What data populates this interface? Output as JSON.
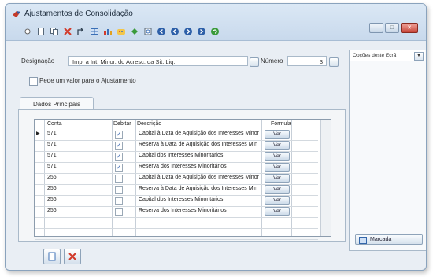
{
  "window": {
    "title": "Ajustamentos de Consolidação",
    "controls": [
      "minimize",
      "maximize",
      "close"
    ]
  },
  "toolbar": {
    "icons": [
      "dropdown-icon",
      "new-doc-icon",
      "copy-icon",
      "delete-icon",
      "arrows-icon",
      "grid-icon",
      "chart-icon",
      "palette-icon",
      "puzzle-icon",
      "print-preview-icon",
      "nav-first-icon",
      "nav-prev-icon",
      "nav-next-icon",
      "nav-last-icon",
      "refresh-icon"
    ]
  },
  "form": {
    "designacao_label": "Designação",
    "designacao_value": "Imp. a Int. Minor. do Acresc. da Sit. Liq.",
    "numero_label": "Número",
    "numero_value": "3",
    "pede_valor_label": "Pede um valor para o Ajustamento"
  },
  "tabs": [
    {
      "label": "Dados Principais"
    }
  ],
  "grid": {
    "headers": {
      "conta": "Conta",
      "debitar": "Debitar",
      "descricao": "Descrição",
      "formula": "Fórmula"
    },
    "rows": [
      {
        "conta": "571",
        "debitar": true,
        "descricao": "Capital à Data de Aquisição dos Interesses Minor",
        "formula": "Ver"
      },
      {
        "conta": "571",
        "debitar": true,
        "descricao": "Reserva à Data de Aquisição dos Interesses Min",
        "formula": "Ver"
      },
      {
        "conta": "571",
        "debitar": true,
        "descricao": "Capital dos Interesses Minoritários",
        "formula": "Ver"
      },
      {
        "conta": "571",
        "debitar": true,
        "descricao": "Reserva dos Interesses Minoritários",
        "formula": "Ver"
      },
      {
        "conta": "256",
        "debitar": false,
        "descricao": "Capital à Data de Aquisição dos Interesses Minor",
        "formula": "Ver"
      },
      {
        "conta": "256",
        "debitar": false,
        "descricao": "Reserva à Data de Aquisição dos Interesses Min",
        "formula": "Ver"
      },
      {
        "conta": "256",
        "debitar": false,
        "descricao": "Capital dos Interesses Minoritários",
        "formula": "Ver"
      },
      {
        "conta": "256",
        "debitar": false,
        "descricao": "Reserva dos Interesses Minoritários",
        "formula": "Ver"
      }
    ]
  },
  "right_panel": {
    "select_value": "Opções deste Ecrã",
    "marcada_label": "Marcada"
  },
  "colors": {
    "accent": "#3b6fb6",
    "delete_red": "#d23a2a"
  }
}
